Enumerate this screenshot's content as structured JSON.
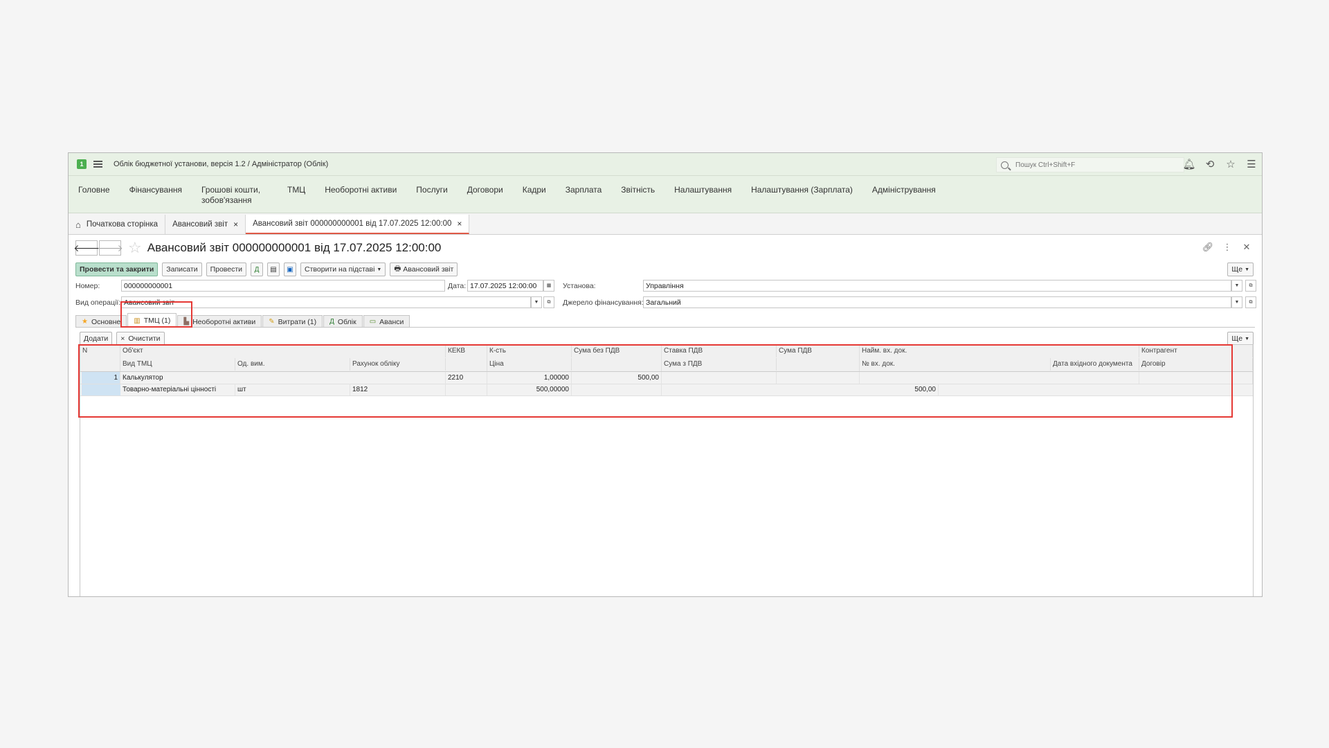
{
  "window": {
    "title": "Облік бюджетної установи, версія 1.2 / Адміністратор  (Облік)",
    "search_placeholder": "Пошук Ctrl+Shift+F"
  },
  "main_menu": [
    "Головне",
    "Фінансування",
    "Грошові кошти, зобов'язання",
    "ТМЦ",
    "Необоротні активи",
    "Послуги",
    "Договори",
    "Кадри",
    "Зарплата",
    "Звітність",
    "Налаштування",
    "Налаштування (Зарплата)",
    "Адміністрування"
  ],
  "open_tabs": {
    "home": "Початкова сторінка",
    "tab1": "Авансовий звіт",
    "tab2": "Авансовий звіт 000000000001 від 17.07.2025 12:00:00"
  },
  "form": {
    "title": "Авансовий звіт 000000000001 від 17.07.2025 12:00:00",
    "buttons": {
      "post_close": "Провести та закрити",
      "save": "Записати",
      "post": "Провести",
      "create_based": "Створити на підставі",
      "print": "Авансовий звіт",
      "more": "Ще"
    },
    "fields": {
      "number_label": "Номер:",
      "number": "000000000001",
      "date_label": "Дата:",
      "date": "17.07.2025 12:00:00",
      "institution_label": "Установа:",
      "institution": "Управління",
      "operation_label": "Вид операції:",
      "operation": "Авансовий звіт",
      "source_label": "Джерело фінансування:",
      "source": "Загальний"
    },
    "section_tabs": [
      "Основне",
      "ТМЦ (1)",
      "Необоротні активи",
      "Витрати (1)",
      "Облік",
      "Аванси"
    ],
    "table_buttons": {
      "add": "Додати",
      "clear": "Очистити",
      "more": "Ще"
    }
  },
  "table": {
    "headers_row1": [
      "N",
      "Об'єкт",
      "КЕКВ",
      "К-сть",
      "Сума без ПДВ",
      "Ставка ПДВ",
      "Сума ПДВ",
      "Найм. вх. док.",
      "Контрагент"
    ],
    "headers_row2": [
      "Вид ТМЦ",
      "Од. вим.",
      "Рахунок обліку",
      "Ціна",
      "Сума з ПДВ",
      "№ вх. док.",
      "Дата вхідного документа",
      "Договір"
    ],
    "rows": [
      {
        "n": "1",
        "object": "Калькулятор",
        "kekv": "2210",
        "qty": "1,00000",
        "sum_no_vat": "500,00",
        "type": "Товарно-матеріальні цінності",
        "unit": "шт",
        "account": "1812",
        "price": "500,00000",
        "sum_vat": "500,00"
      }
    ]
  },
  "colors": {
    "accent_red": "#e53935",
    "menu_bg": "#e8f1e5",
    "primary_btn": "#b9dfcc"
  }
}
